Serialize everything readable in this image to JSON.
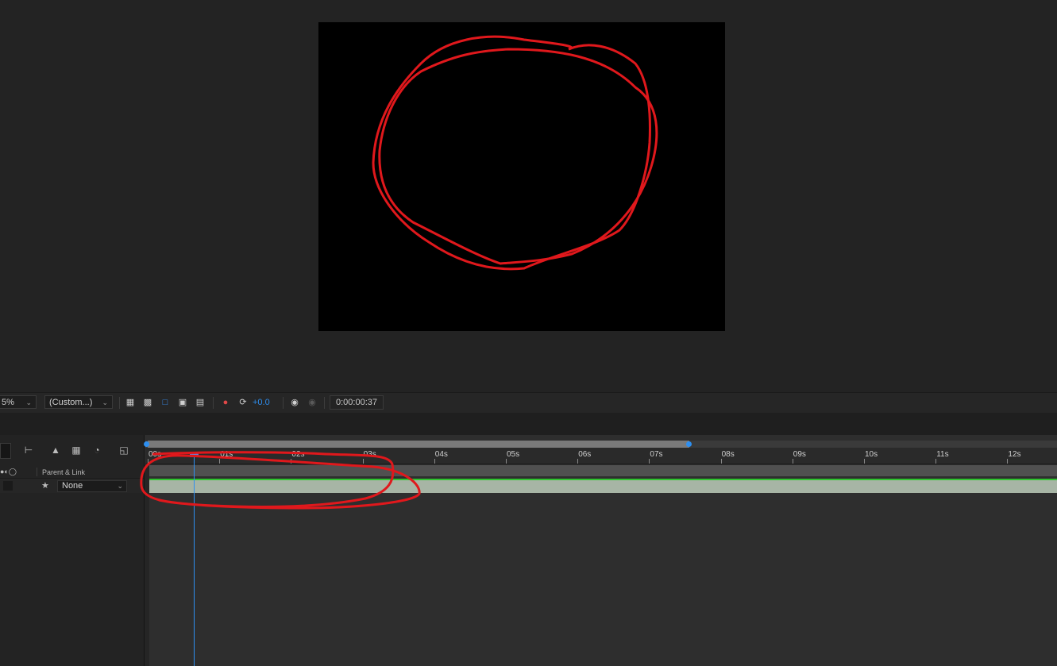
{
  "viewer": {
    "zoom_value": "5%",
    "resolution_value": "(Custom...)",
    "exposure": "+0.0",
    "timecode": "0:00:00:37",
    "icons": [
      "region-of-interest-icon",
      "transparency-grid-icon",
      "mask-path-icon",
      "safe-margins-icon",
      "grid-guides-icon",
      "color-channel-icon",
      "reset-exposure-icon",
      "snapshot-camera-icon",
      "show-snapshot-icon"
    ]
  },
  "timeline": {
    "columns": {
      "parent_link": "Parent & Link"
    },
    "layer": {
      "parent_value": "None"
    },
    "ruler_labels": [
      "00s",
      "01s",
      "02s",
      "03s",
      "04s",
      "05s",
      "06s",
      "07s",
      "08s",
      "09s",
      "10s",
      "11s",
      "12s"
    ],
    "tool_icons": [
      "composition-flowchart-icon",
      "draft-3d-icon",
      "frame-blending-icon",
      "motion-blur-icon",
      "graph-editor-icon"
    ]
  },
  "colors": {
    "playhead": "#2e8ff0",
    "layer_bar": "#a7b5a5",
    "annotation": "#e0181c"
  }
}
